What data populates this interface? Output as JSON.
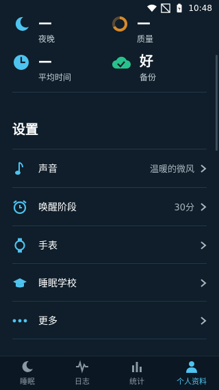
{
  "status": {
    "time": "10:48"
  },
  "stats": [
    {
      "value": "—",
      "label": "夜晚",
      "icon": "moon-icon"
    },
    {
      "value": "—",
      "label": "质量",
      "icon": "quality-ring-icon"
    },
    {
      "value": "—",
      "label": "平均时间",
      "icon": "clock-icon"
    },
    {
      "value": "好",
      "label": "备份",
      "icon": "cloud-check-icon"
    }
  ],
  "settings": {
    "title": "设置",
    "items": [
      {
        "label": "声音",
        "value": "温暖的微风",
        "icon": "music-note-icon"
      },
      {
        "label": "唤醒阶段",
        "value": "30分",
        "icon": "alarm-clock-icon"
      },
      {
        "label": "手表",
        "value": "",
        "icon": "watch-icon"
      },
      {
        "label": "睡眠学校",
        "value": "",
        "icon": "graduation-cap-icon"
      },
      {
        "label": "更多",
        "value": "",
        "icon": "more-dots-icon"
      }
    ]
  },
  "tabs": [
    {
      "label": "睡眠",
      "icon": "moon-icon"
    },
    {
      "label": "日志",
      "icon": "wave-icon"
    },
    {
      "label": "统计",
      "icon": "bar-chart-icon"
    },
    {
      "label": "个人资料",
      "icon": "person-icon",
      "active": true
    }
  ],
  "colors": {
    "accent": "#4ec3f0",
    "green": "#27c28b",
    "orange": "#d8892a",
    "background": "#0f1e2a"
  }
}
